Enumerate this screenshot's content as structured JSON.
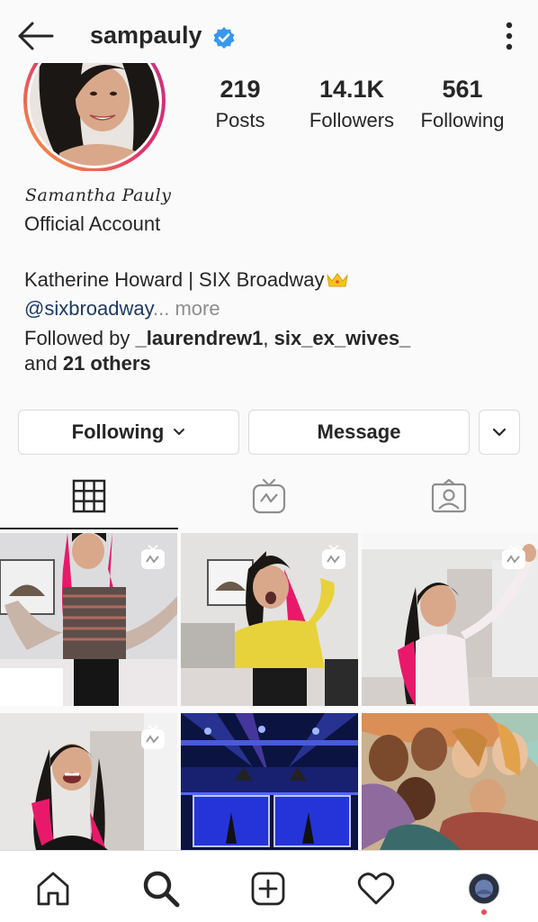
{
  "header": {
    "username": "sampauly",
    "back_icon": "arrow-left-icon",
    "verified_icon": "verified-badge-icon",
    "menu_icon": "more-vertical-icon"
  },
  "stats": {
    "posts": {
      "value": "219",
      "label": "Posts"
    },
    "followers": {
      "value": "14.1K",
      "label": "Followers"
    },
    "following": {
      "value": "561",
      "label": "Following"
    }
  },
  "bio": {
    "signature": "Samantha Pauly",
    "category": "Official Account",
    "line1": "Katherine Howard | SIX Broadway",
    "mention": "@sixbroadway",
    "ellipsis": "...",
    "more": " more",
    "followed_prefix": "Followed by ",
    "followed_user1": "_laurendrew1",
    "followed_sep": ", ",
    "followed_user2": "six_ex_wives_",
    "followed_and": "and ",
    "followed_others": "21 others"
  },
  "actions": {
    "following_label": "Following",
    "message_label": "Message"
  },
  "tabs": [
    {
      "name": "grid",
      "icon": "grid-icon",
      "active": true
    },
    {
      "name": "igtv",
      "icon": "igtv-icon",
      "active": false
    },
    {
      "name": "tagged",
      "icon": "tagged-person-icon",
      "active": false
    }
  ],
  "bottom_nav": [
    "home-icon",
    "search-icon",
    "add-post-icon",
    "heart-icon",
    "profile-avatar"
  ],
  "colors": {
    "verified": "#3897f0",
    "mention": "#1e3a62",
    "muted": "#8e8e8e",
    "notification_dot": "#ed4956",
    "hair_pink": "#e8196b"
  }
}
